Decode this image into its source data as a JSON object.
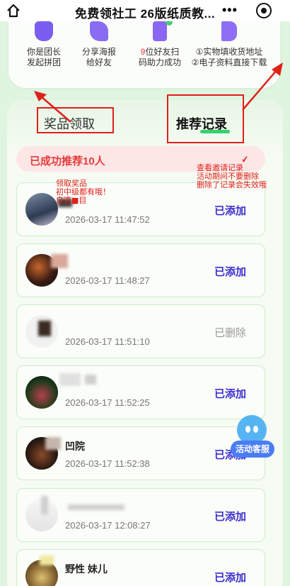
{
  "nav": {
    "title": "免费领社工 26版纸质教...",
    "more_label": "•••"
  },
  "steps": [
    {
      "icon": "flag-icon",
      "line1": "你是团长",
      "line2": "发起拼团"
    },
    {
      "icon": "share-icon",
      "line1": "分享海报",
      "line2": "给好友"
    },
    {
      "icon": "phone-icon",
      "line1_red": "9",
      "line1": "位好友扫",
      "line2": "码助力成功"
    },
    {
      "icon": "flag-icon",
      "line1": "①实物填收货地址",
      "line2": "②电子资料直接下载"
    }
  ],
  "tabs": {
    "prizes": "奖品领取",
    "records": "推荐记录"
  },
  "summary": {
    "text": "已成功推荐10人",
    "check": "✔"
  },
  "annotations": {
    "right": [
      "查看邀请记录",
      "活动期间不要删除",
      "删除了记录会失效哦"
    ],
    "left": [
      "领取奖品",
      "初中级都有哦！",
      "自选■目"
    ]
  },
  "records": [
    {
      "name": "",
      "time": "2026-03-17 11:47:52",
      "status": "已添加",
      "deleted": false
    },
    {
      "name": "",
      "time": "2026-03-17 11:48:27",
      "status": "已添加",
      "deleted": false
    },
    {
      "name": "",
      "time": "2026-03-17 11:51:10",
      "status": "已删除",
      "deleted": true
    },
    {
      "name": "",
      "time": "2026-03-17 11:52:25",
      "status": "已添加",
      "deleted": false
    },
    {
      "name": "凹院",
      "time": "2026-03-17 11:52:38",
      "status": "已添加",
      "deleted": false
    },
    {
      "name": "",
      "time": "2026-03-17 12:08:27",
      "status": "已添加",
      "deleted": false
    },
    {
      "name": "野性  妹儿",
      "time": "",
      "status": "已添加",
      "deleted": false
    }
  ],
  "service": {
    "label": "活动客服"
  },
  "colors": {
    "accent_green": "#35d06c",
    "status_added": "#3d2fd0",
    "status_deleted": "#999999",
    "summary_red": "#e53b3b",
    "annotation_red": "#e0201a"
  }
}
